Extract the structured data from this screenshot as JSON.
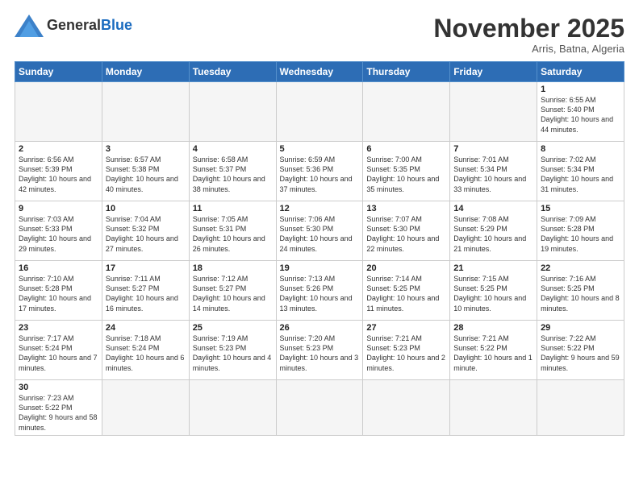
{
  "logo": {
    "general": "General",
    "blue": "Blue"
  },
  "title": "November 2025",
  "location": "Arris, Batna, Algeria",
  "days_of_week": [
    "Sunday",
    "Monday",
    "Tuesday",
    "Wednesday",
    "Thursday",
    "Friday",
    "Saturday"
  ],
  "weeks": [
    [
      {
        "day": "",
        "info": ""
      },
      {
        "day": "",
        "info": ""
      },
      {
        "day": "",
        "info": ""
      },
      {
        "day": "",
        "info": ""
      },
      {
        "day": "",
        "info": ""
      },
      {
        "day": "",
        "info": ""
      },
      {
        "day": "1",
        "info": "Sunrise: 6:55 AM\nSunset: 5:40 PM\nDaylight: 10 hours\nand 44 minutes."
      }
    ],
    [
      {
        "day": "2",
        "info": "Sunrise: 6:56 AM\nSunset: 5:39 PM\nDaylight: 10 hours\nand 42 minutes."
      },
      {
        "day": "3",
        "info": "Sunrise: 6:57 AM\nSunset: 5:38 PM\nDaylight: 10 hours\nand 40 minutes."
      },
      {
        "day": "4",
        "info": "Sunrise: 6:58 AM\nSunset: 5:37 PM\nDaylight: 10 hours\nand 38 minutes."
      },
      {
        "day": "5",
        "info": "Sunrise: 6:59 AM\nSunset: 5:36 PM\nDaylight: 10 hours\nand 37 minutes."
      },
      {
        "day": "6",
        "info": "Sunrise: 7:00 AM\nSunset: 5:35 PM\nDaylight: 10 hours\nand 35 minutes."
      },
      {
        "day": "7",
        "info": "Sunrise: 7:01 AM\nSunset: 5:34 PM\nDaylight: 10 hours\nand 33 minutes."
      },
      {
        "day": "8",
        "info": "Sunrise: 7:02 AM\nSunset: 5:34 PM\nDaylight: 10 hours\nand 31 minutes."
      }
    ],
    [
      {
        "day": "9",
        "info": "Sunrise: 7:03 AM\nSunset: 5:33 PM\nDaylight: 10 hours\nand 29 minutes."
      },
      {
        "day": "10",
        "info": "Sunrise: 7:04 AM\nSunset: 5:32 PM\nDaylight: 10 hours\nand 27 minutes."
      },
      {
        "day": "11",
        "info": "Sunrise: 7:05 AM\nSunset: 5:31 PM\nDaylight: 10 hours\nand 26 minutes."
      },
      {
        "day": "12",
        "info": "Sunrise: 7:06 AM\nSunset: 5:30 PM\nDaylight: 10 hours\nand 24 minutes."
      },
      {
        "day": "13",
        "info": "Sunrise: 7:07 AM\nSunset: 5:30 PM\nDaylight: 10 hours\nand 22 minutes."
      },
      {
        "day": "14",
        "info": "Sunrise: 7:08 AM\nSunset: 5:29 PM\nDaylight: 10 hours\nand 21 minutes."
      },
      {
        "day": "15",
        "info": "Sunrise: 7:09 AM\nSunset: 5:28 PM\nDaylight: 10 hours\nand 19 minutes."
      }
    ],
    [
      {
        "day": "16",
        "info": "Sunrise: 7:10 AM\nSunset: 5:28 PM\nDaylight: 10 hours\nand 17 minutes."
      },
      {
        "day": "17",
        "info": "Sunrise: 7:11 AM\nSunset: 5:27 PM\nDaylight: 10 hours\nand 16 minutes."
      },
      {
        "day": "18",
        "info": "Sunrise: 7:12 AM\nSunset: 5:27 PM\nDaylight: 10 hours\nand 14 minutes."
      },
      {
        "day": "19",
        "info": "Sunrise: 7:13 AM\nSunset: 5:26 PM\nDaylight: 10 hours\nand 13 minutes."
      },
      {
        "day": "20",
        "info": "Sunrise: 7:14 AM\nSunset: 5:25 PM\nDaylight: 10 hours\nand 11 minutes."
      },
      {
        "day": "21",
        "info": "Sunrise: 7:15 AM\nSunset: 5:25 PM\nDaylight: 10 hours\nand 10 minutes."
      },
      {
        "day": "22",
        "info": "Sunrise: 7:16 AM\nSunset: 5:25 PM\nDaylight: 10 hours\nand 8 minutes."
      }
    ],
    [
      {
        "day": "23",
        "info": "Sunrise: 7:17 AM\nSunset: 5:24 PM\nDaylight: 10 hours\nand 7 minutes."
      },
      {
        "day": "24",
        "info": "Sunrise: 7:18 AM\nSunset: 5:24 PM\nDaylight: 10 hours\nand 6 minutes."
      },
      {
        "day": "25",
        "info": "Sunrise: 7:19 AM\nSunset: 5:23 PM\nDaylight: 10 hours\nand 4 minutes."
      },
      {
        "day": "26",
        "info": "Sunrise: 7:20 AM\nSunset: 5:23 PM\nDaylight: 10 hours\nand 3 minutes."
      },
      {
        "day": "27",
        "info": "Sunrise: 7:21 AM\nSunset: 5:23 PM\nDaylight: 10 hours\nand 2 minutes."
      },
      {
        "day": "28",
        "info": "Sunrise: 7:21 AM\nSunset: 5:22 PM\nDaylight: 10 hours\nand 1 minute."
      },
      {
        "day": "29",
        "info": "Sunrise: 7:22 AM\nSunset: 5:22 PM\nDaylight: 9 hours\nand 59 minutes."
      }
    ],
    [
      {
        "day": "30",
        "info": "Sunrise: 7:23 AM\nSunset: 5:22 PM\nDaylight: 9 hours\nand 58 minutes."
      },
      {
        "day": "",
        "info": ""
      },
      {
        "day": "",
        "info": ""
      },
      {
        "day": "",
        "info": ""
      },
      {
        "day": "",
        "info": ""
      },
      {
        "day": "",
        "info": ""
      },
      {
        "day": "",
        "info": ""
      }
    ]
  ]
}
